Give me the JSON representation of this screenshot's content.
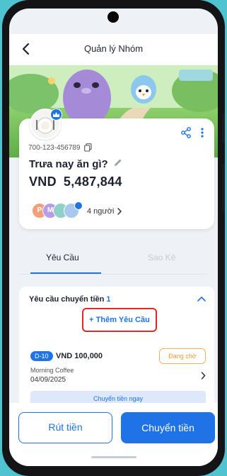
{
  "header": {
    "title": "Quản lý Nhóm"
  },
  "group": {
    "account_number": "700-123-456789",
    "name": "Trưa nay ăn gì?",
    "currency": "VND",
    "balance": "5,487,844",
    "member_count": "4 người",
    "member_initials": [
      "P",
      "M",
      "",
      ""
    ]
  },
  "tabs": [
    {
      "label": "Yêu Cầu",
      "active": true
    },
    {
      "label": "Sao Kê",
      "active": false
    }
  ],
  "requests": {
    "heading": "Yêu cầu chuyển tiền",
    "count": "1",
    "add_label": "+ Thêm Yêu Cầu",
    "items": [
      {
        "tag": "D-10",
        "amount": "VND 100,000",
        "status": "Đang chờ",
        "description": "Morning Coffee",
        "date": "04/09/2025",
        "action_label": "Chuyển tiền ngay"
      }
    ]
  },
  "actions": {
    "withdraw_label": "Rút tiền",
    "transfer_label": "Chuyển tiền"
  },
  "colors": {
    "primary": "#1f73e6",
    "highlight": "#d62c2c",
    "pending": "#f09a2a"
  }
}
